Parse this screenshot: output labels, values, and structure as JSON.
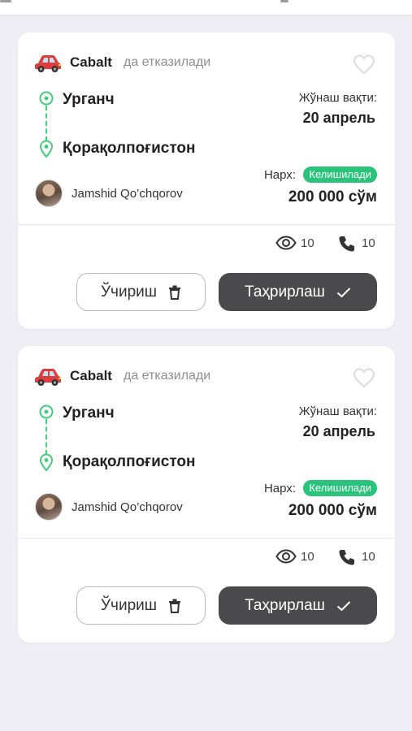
{
  "colors": {
    "background": "#eeeef4",
    "card": "#ffffff",
    "accent_green": "#29c47a",
    "route_green": "#3fcf7a",
    "car_red": "#e23b3b",
    "edit_button": "#4a4a4c"
  },
  "listings": [
    {
      "car_icon": "red-car-emoji",
      "car_model": "Cabalt",
      "car_delivers": "да етказилади",
      "origin": "Урганч",
      "destination": "Қорақолпоғистон",
      "departure_label": "Жўнаш вақти:",
      "departure_date": "20 апрель",
      "driver_name": "Jamshid Qo’chqorov",
      "price_label": "Нарх:",
      "price_badge": "Келишилади",
      "price_value": "200 000 сўм",
      "views": "10",
      "calls": "10",
      "delete_label": "Ўчириш",
      "edit_label": "Таҳрирлаш"
    },
    {
      "car_icon": "red-car-emoji",
      "car_model": "Cabalt",
      "car_delivers": "да етказилади",
      "origin": "Урганч",
      "destination": "Қорақолпоғистон",
      "departure_label": "Жўнаш вақти:",
      "departure_date": "20 апрель",
      "driver_name": "Jamshid Qo’chqorov",
      "price_label": "Нарх:",
      "price_badge": "Келишилади",
      "price_value": "200 000 сўм",
      "views": "10",
      "calls": "10",
      "delete_label": "Ўчириш",
      "edit_label": "Таҳрирлаш"
    }
  ]
}
